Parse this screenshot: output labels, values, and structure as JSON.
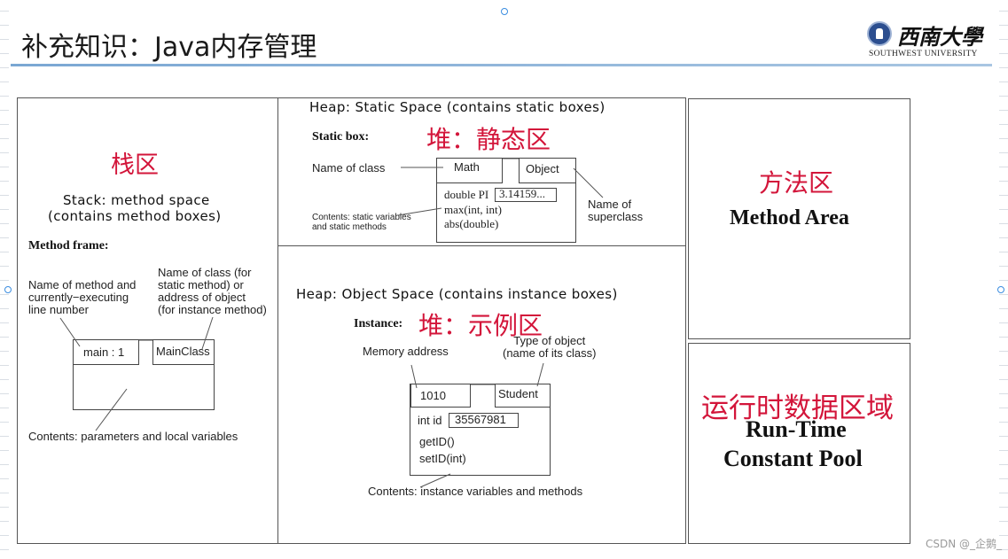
{
  "slide": {
    "title": "补充知识：Java内存管理",
    "logo": {
      "name_cn": "西南大學",
      "name_en": "SOUTHWEST UNIVERSITY"
    },
    "accent_color": "#d3153a",
    "rule_color": "#7aa7d3"
  },
  "stack_panel": {
    "label_cn": "栈区",
    "heading_line1": "Stack: method space",
    "heading_line2": "(contains method boxes)",
    "frame_label": "Method frame:",
    "annot_method": [
      "Name of method and",
      "currently−executing",
      "line number"
    ],
    "annot_class": [
      "Name of class (for",
      "static method) or",
      "address of object",
      "(for instance method)"
    ],
    "frame_name": "main : 1",
    "frame_class": "MainClass",
    "annot_contents": "Contents: parameters and local variables"
  },
  "static_panel": {
    "heading": "Heap: Static Space (contains static boxes)",
    "box_label": "Static box:",
    "label_cn": "堆：静态区",
    "annot_class": "Name of class",
    "class_name": "Math",
    "superclass": "Object",
    "field_label": "double PI",
    "field_value": "3.14159...",
    "methods": [
      "max(int, int)",
      "abs(double)"
    ],
    "annot_contents": [
      "Contents: static variables",
      "and static methods"
    ],
    "annot_super": [
      "Name of",
      "superclass"
    ]
  },
  "object_panel": {
    "heading": "Heap: Object Space (contains instance boxes)",
    "box_label": "Instance:",
    "label_cn": "堆：示例区",
    "annot_address": "Memory address",
    "annot_type": [
      "Type of object",
      "(name of its class)"
    ],
    "address": "1010",
    "type": "Student",
    "field_label": "int id",
    "field_value": "35567981",
    "methods": [
      "getID()",
      "setID(int)"
    ],
    "annot_contents": "Contents: instance variables and methods"
  },
  "method_area_panel": {
    "label_cn": "方法区",
    "label_en": "Method Area"
  },
  "constant_pool_panel": {
    "label_cn": "运行时数据区域",
    "label_en_line1": "Run-Time",
    "label_en_line2": "Constant Pool"
  },
  "watermark": "CSDN @_企鹅_"
}
